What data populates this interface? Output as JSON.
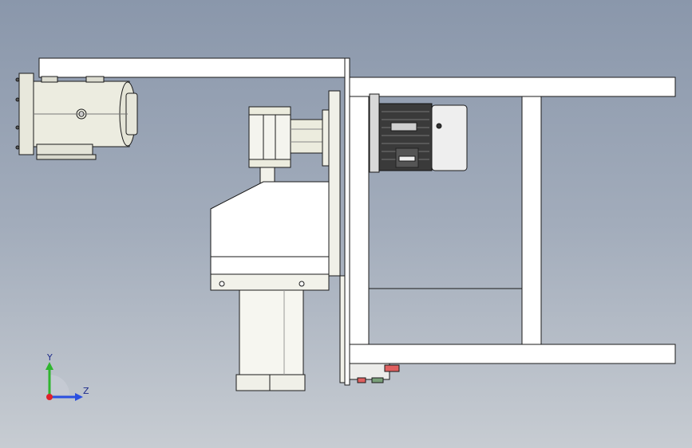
{
  "triad": {
    "y_label": "Y",
    "z_label": "Z",
    "x_color": "#e0202a",
    "y_color": "#2fb52f",
    "z_color": "#2a4fe0"
  },
  "colors": {
    "body_fill": "#ffffff",
    "metal_fill": "#e9e9de",
    "line": "#1a1a1a",
    "background_top": "#8a97ab",
    "background_bottom": "#c7ccd2"
  }
}
